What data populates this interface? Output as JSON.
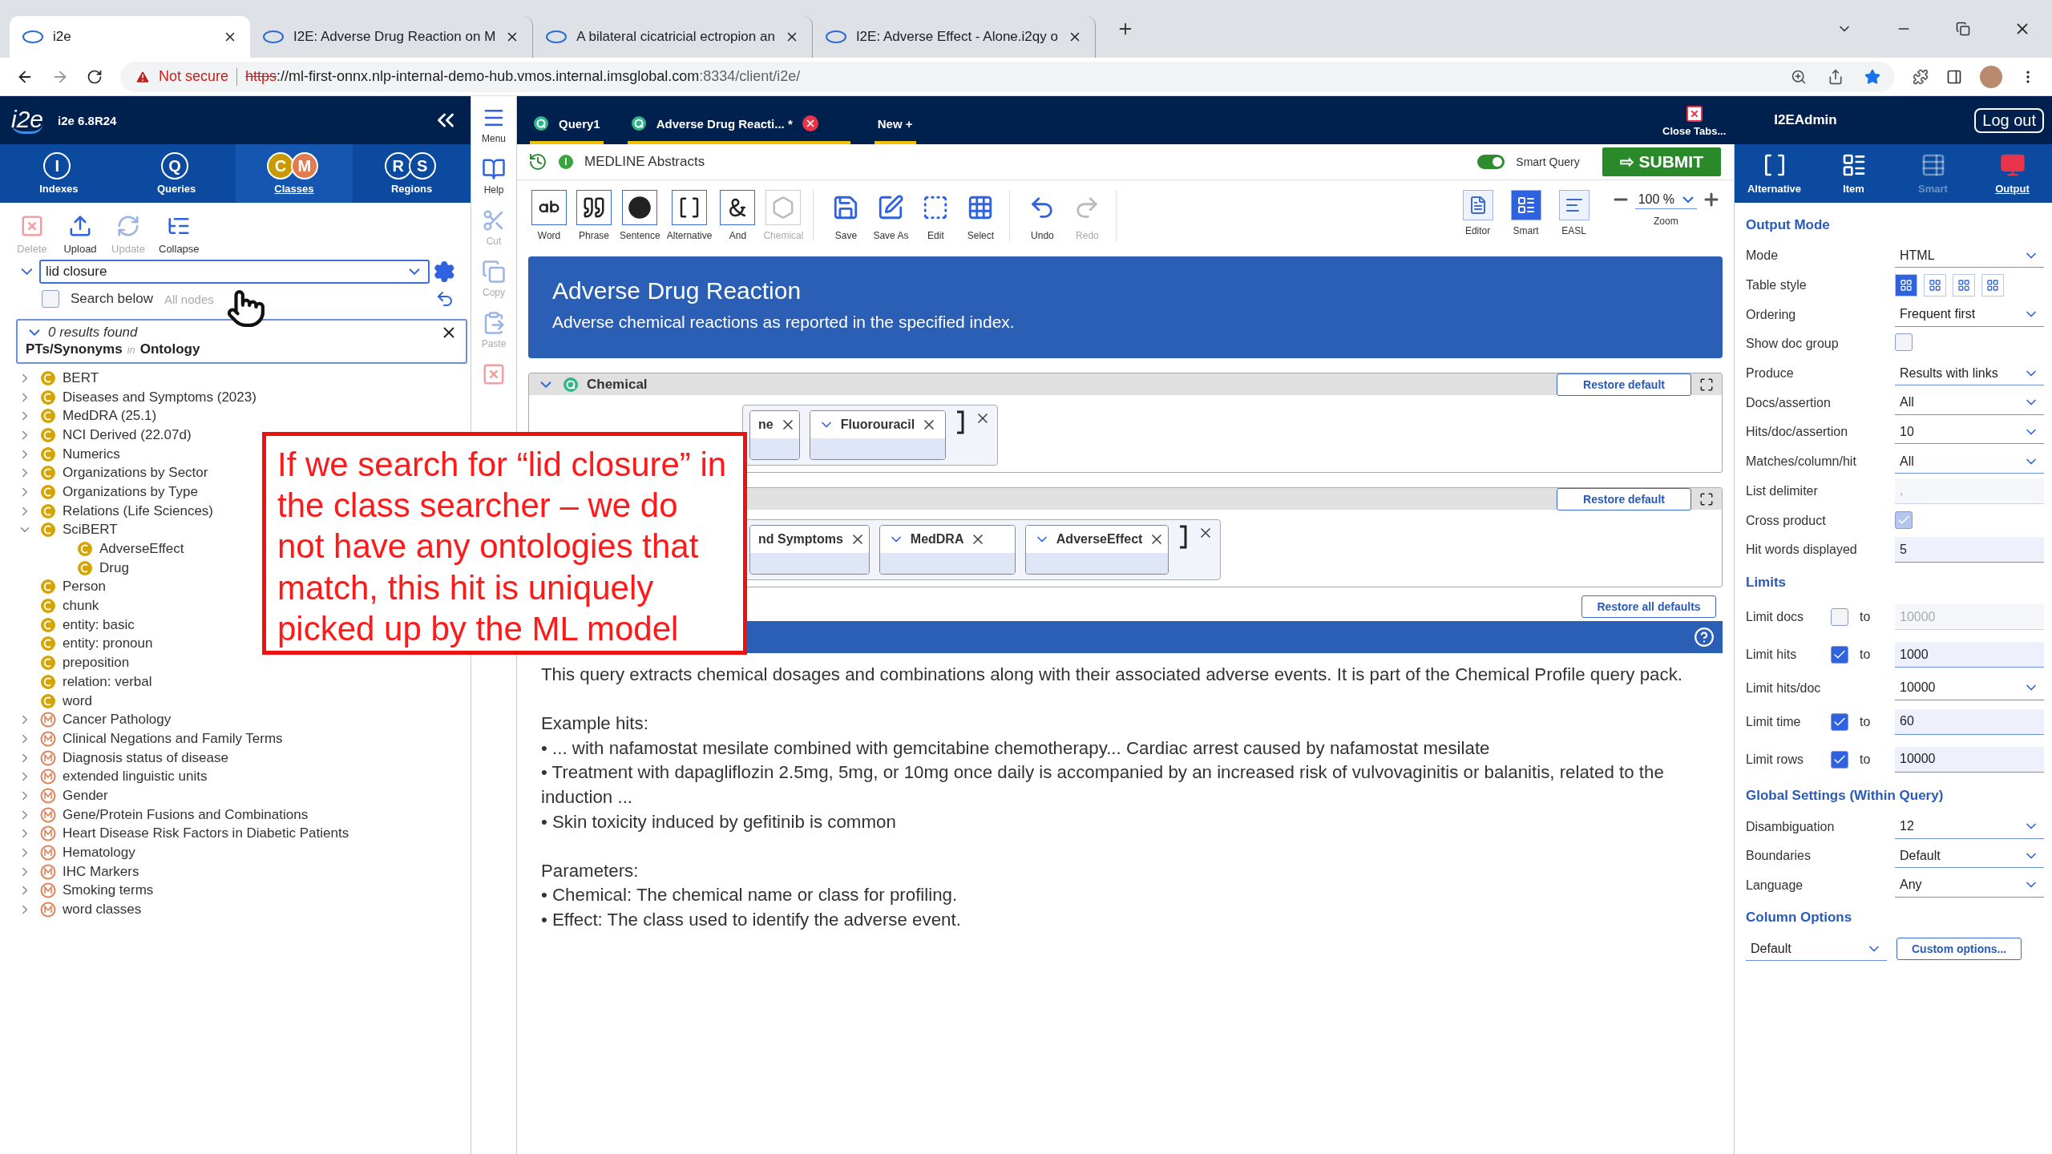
{
  "browser": {
    "tabs": [
      {
        "title": "i2e",
        "selected": true
      },
      {
        "title": "I2E: Adverse Drug Reaction on M",
        "selected": false
      },
      {
        "title": "A bilateral cicatricial ectropion an",
        "selected": false
      },
      {
        "title": "I2E: Adverse Effect - Alone.i2qy o",
        "selected": false
      }
    ],
    "address": {
      "security": "Not secure",
      "scheme": "https",
      "host": "://ml-first-onnx.nlp-internal-demo-hub.vmos.internal.imsglobal.com",
      "path": ":8334/client/i2e/"
    }
  },
  "app": {
    "logo": "i2e",
    "version": "i2e 6.8R24",
    "close_tabs": "Close Tabs...",
    "user": "I2EAdmin",
    "logout": "Log out"
  },
  "left_nav": [
    {
      "label": "Indexes",
      "badges": [
        "I"
      ],
      "selected": false
    },
    {
      "label": "Queries",
      "badges": [
        "Q"
      ],
      "selected": false
    },
    {
      "label": "Classes",
      "badges": [
        "C",
        "M"
      ],
      "selected": true
    },
    {
      "label": "Regions",
      "badges": [
        "R",
        "S"
      ],
      "selected": false
    }
  ],
  "class_toolbar": [
    {
      "kind": "delete",
      "label": "Delete",
      "disabled": true
    },
    {
      "kind": "upload",
      "label": "Upload",
      "disabled": false
    },
    {
      "kind": "update",
      "label": "Update",
      "disabled": true
    },
    {
      "kind": "collapse",
      "label": "Collapse",
      "disabled": false
    }
  ],
  "search": {
    "value": "lid closure",
    "search_below_label": "Search below",
    "search_below": false,
    "placeholder": "All nodes"
  },
  "results": {
    "summary": "0 results found",
    "field": "PTs/Synonyms",
    "joiner": "in",
    "scope": "Ontology"
  },
  "tree": [
    {
      "label": "BERT",
      "kind": "class",
      "expanded": false
    },
    {
      "label": "Diseases and Symptoms (2023)",
      "kind": "class",
      "expanded": false
    },
    {
      "label": "MedDRA (25.1)",
      "kind": "class",
      "expanded": false
    },
    {
      "label": "NCI Derived (22.07d)",
      "kind": "class",
      "expanded": false
    },
    {
      "label": "Numerics",
      "kind": "class",
      "expanded": false
    },
    {
      "label": "Organizations by Sector",
      "kind": "class",
      "expanded": false
    },
    {
      "label": "Organizations by Type",
      "kind": "class",
      "expanded": false
    },
    {
      "label": "Relations (Life Sciences)",
      "kind": "class",
      "expanded": false
    },
    {
      "label": "SciBERT",
      "kind": "class",
      "expanded": true,
      "children": [
        {
          "label": "AdverseEffect",
          "kind": "class"
        },
        {
          "label": "Drug",
          "kind": "class"
        }
      ]
    },
    {
      "label": "Person",
      "kind": "class"
    },
    {
      "label": "chunk",
      "kind": "class"
    },
    {
      "label": "entity: basic",
      "kind": "class"
    },
    {
      "label": "entity: pronoun",
      "kind": "class"
    },
    {
      "label": "preposition",
      "kind": "class"
    },
    {
      "label": "relation: verbal",
      "kind": "class"
    },
    {
      "label": "word",
      "kind": "class"
    },
    {
      "label": "Cancer Pathology",
      "kind": "module",
      "expanded": false
    },
    {
      "label": "Clinical Negations and Family Terms",
      "kind": "module",
      "expanded": false
    },
    {
      "label": "Diagnosis status of disease",
      "kind": "module",
      "expanded": false
    },
    {
      "label": "extended linguistic units",
      "kind": "module",
      "expanded": false
    },
    {
      "label": "Gender",
      "kind": "module",
      "expanded": false
    },
    {
      "label": "Gene/Protein Fusions and Combinations",
      "kind": "module",
      "expanded": false
    },
    {
      "label": "Heart Disease Risk Factors in Diabetic Patients",
      "kind": "module",
      "expanded": false
    },
    {
      "label": "Hematology",
      "kind": "module",
      "expanded": false
    },
    {
      "label": "IHC Markers",
      "kind": "module",
      "expanded": false
    },
    {
      "label": "Smoking terms",
      "kind": "module",
      "expanded": false
    },
    {
      "label": "word classes",
      "kind": "module",
      "expanded": false
    }
  ],
  "menu_strip": [
    {
      "kind": "menu",
      "label": "Menu",
      "disabled": false
    },
    {
      "kind": "help",
      "label": "Help",
      "disabled": false
    },
    {
      "kind": "cut",
      "label": "Cut",
      "disabled": true
    },
    {
      "kind": "copy",
      "label": "Copy",
      "disabled": true
    },
    {
      "kind": "paste",
      "label": "Paste",
      "disabled": true
    },
    {
      "kind": "delete",
      "disabled": true
    }
  ],
  "query_tabs": [
    {
      "kind": "query",
      "label": "Query1",
      "closable": false
    },
    {
      "kind": "query",
      "label": "Adverse Drug Reacti... *",
      "closable": true
    },
    {
      "kind": "new",
      "label": "New +",
      "closable": false
    }
  ],
  "source": {
    "badge": "I",
    "label": "MEDLINE Abstracts"
  },
  "smart_query": {
    "label": "Smart Query",
    "on": true
  },
  "submit": "⇨ SUBMIT",
  "toolbar": [
    [
      {
        "kind": "word",
        "label": "Word",
        "disabled": false
      },
      {
        "kind": "phrase",
        "label": "Phrase",
        "disabled": false
      },
      {
        "kind": "sentence",
        "label": "Sentence",
        "disabled": false
      },
      {
        "kind": "alternative",
        "label": "Alternative",
        "disabled": false
      },
      {
        "kind": "and",
        "label": "And",
        "disabled": false
      },
      {
        "kind": "chemical",
        "label": "Chemical",
        "disabled": true
      }
    ],
    [
      {
        "kind": "save",
        "label": "Save",
        "disabled": false
      },
      {
        "kind": "save_as",
        "label": "Save As",
        "disabled": false
      },
      {
        "kind": "edit",
        "label": "Edit",
        "disabled": false
      },
      {
        "kind": "select",
        "label": "Select",
        "disabled": false
      }
    ],
    [
      {
        "kind": "undo",
        "label": "Undo",
        "disabled": false
      },
      {
        "kind": "redo",
        "label": "Redo",
        "disabled": true
      }
    ]
  ],
  "view_buttons": [
    {
      "kind": "editor",
      "label": "Editor",
      "selected": false
    },
    {
      "kind": "smart",
      "label": "Smart",
      "selected": true
    },
    {
      "kind": "easl",
      "label": "EASL",
      "selected": false
    }
  ],
  "zoom": {
    "value": "100 %",
    "label": "Zoom"
  },
  "banner": {
    "title": "Adverse Drug Reaction",
    "subtitle": "Adverse chemical reactions as reported in the specified index."
  },
  "sections": [
    {
      "title": "Chemical",
      "restore": "Restore default",
      "chips": [
        {
          "label": "ne"
        },
        {
          "label": "Fluorouracil"
        }
      ]
    },
    {
      "restore": "Restore default",
      "chips": [
        {
          "label": "nd Symptoms"
        },
        {
          "label": "MedDRA"
        },
        {
          "label": "AdverseEffect"
        }
      ]
    }
  ],
  "restore_all": "Restore all defaults",
  "description": [
    [
      "This query extracts chemical dosages and combinations along with their associated adverse events. It is part of the Chemical Profile query pack."
    ],
    [
      "Example hits:",
      "• ... with nafamostat mesilate combined with gemcitabine chemotherapy... Cardiac arrest caused by nafamostat mesilate",
      "• Treatment with dapagliflozin 2.5mg, 5mg, or 10mg once daily is accompanied by an increased risk of vulvovaginitis or balanitis, related to the induction ...",
      "• Skin toxicity induced by gefitinib is common"
    ],
    [
      "Parameters:",
      "• Chemical: The chemical name or class for profiling.",
      "• Effect: The class used to identify the adverse event."
    ]
  ],
  "right_nav": [
    {
      "kind": "alternative",
      "label": "Alternative",
      "selected": false,
      "disabled": false
    },
    {
      "kind": "item",
      "label": "Item",
      "selected": false,
      "disabled": false
    },
    {
      "kind": "smart",
      "label": "Smart",
      "selected": false,
      "disabled": true
    },
    {
      "kind": "output",
      "label": "Output",
      "selected": true,
      "disabled": false
    }
  ],
  "settings": [
    {
      "title": "Output Mode",
      "rows": [
        {
          "kind": "select",
          "label": "Mode",
          "value": "HTML"
        },
        {
          "kind": "table_style",
          "label": "Table style",
          "options": [
            {
              "selected": true
            },
            {
              "selected": false
            },
            {
              "selected": false
            },
            {
              "selected": false
            }
          ]
        },
        {
          "kind": "select",
          "label": "Ordering",
          "value": "Frequent first"
        },
        {
          "kind": "checkbox",
          "label": "Show doc group",
          "checked": false
        },
        {
          "kind": "select",
          "label": "Produce",
          "value": "Results with links"
        },
        {
          "kind": "select",
          "label": "Docs/assertion",
          "value": "All"
        },
        {
          "kind": "select",
          "label": "Hits/doc/assertion",
          "value": "10"
        },
        {
          "kind": "select",
          "label": "Matches/column/hit",
          "value": "All"
        },
        {
          "kind": "text",
          "label": "List delimiter",
          "value": ",",
          "disabled": true
        },
        {
          "kind": "checkbox",
          "label": "Cross product",
          "checked": true,
          "disabled": true
        },
        {
          "kind": "text",
          "label": "Hit words displayed",
          "value": "5",
          "disabled": false
        }
      ]
    },
    {
      "title": "Limits",
      "rows": [
        {
          "kind": "limit",
          "label": "Limit docs",
          "checked": false,
          "to": "to",
          "value": "10000"
        },
        {
          "kind": "limit",
          "label": "Limit hits",
          "checked": true,
          "to": "to",
          "value": "1000"
        },
        {
          "kind": "select",
          "label": "Limit hits/doc",
          "value": "10000"
        },
        {
          "kind": "limit",
          "label": "Limit time",
          "checked": true,
          "to": "to",
          "value": "60"
        },
        {
          "kind": "limit",
          "label": "Limit rows",
          "checked": true,
          "to": "to",
          "value": "10000"
        }
      ]
    },
    {
      "title": "Global Settings (Within Query)",
      "rows": [
        {
          "kind": "select",
          "label": "Disambiguation",
          "value": "12"
        },
        {
          "kind": "select",
          "label": "Boundaries",
          "value": "Default"
        },
        {
          "kind": "select",
          "label": "Language",
          "value": "Any"
        }
      ]
    },
    {
      "title": "Column Options",
      "rows": [
        {
          "kind": "columns",
          "value": "Default",
          "button": "Custom options..."
        }
      ]
    }
  ],
  "callout": "If we search for “lid closure” in the class searcher – we do not have any ontologies that match, this hit is uniquely picked up by the ML model"
}
